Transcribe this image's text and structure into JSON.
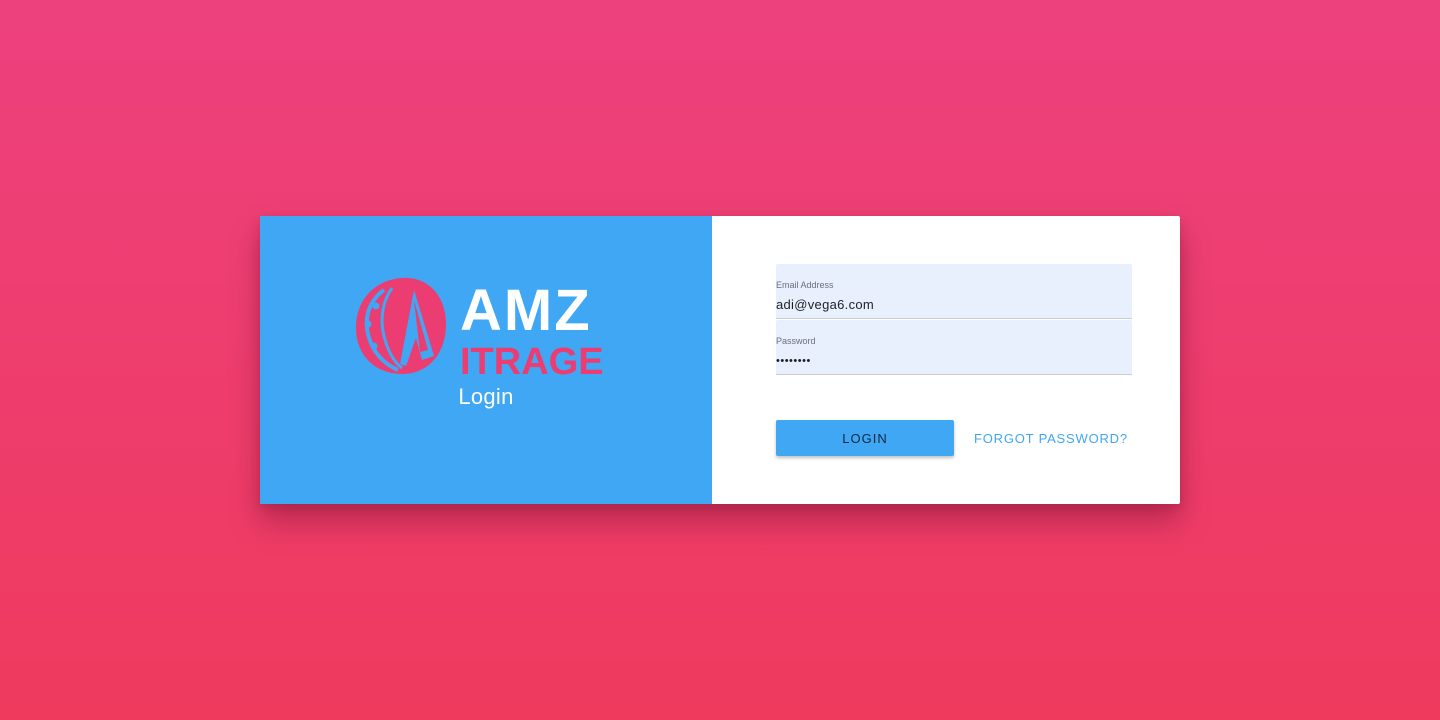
{
  "logo": {
    "primary_text": "AMZ",
    "secondary_text": "ITRAGE",
    "primary_color": "#ffffff",
    "accent_color": "#ec3d73"
  },
  "brand_panel": {
    "title": "Login",
    "background_color": "#3fa7f3"
  },
  "form": {
    "email": {
      "label": "Email Address",
      "value": "adi@vega6.com"
    },
    "password": {
      "label": "Password",
      "value": "••••••••"
    },
    "login_label": "LOGIN",
    "forgot_label": "FORGOT PASSWORD?"
  },
  "colors": {
    "page_gradient_top": "#ed417e",
    "page_gradient_bottom": "#ef3a5e",
    "input_background": "#e8f0fe"
  }
}
